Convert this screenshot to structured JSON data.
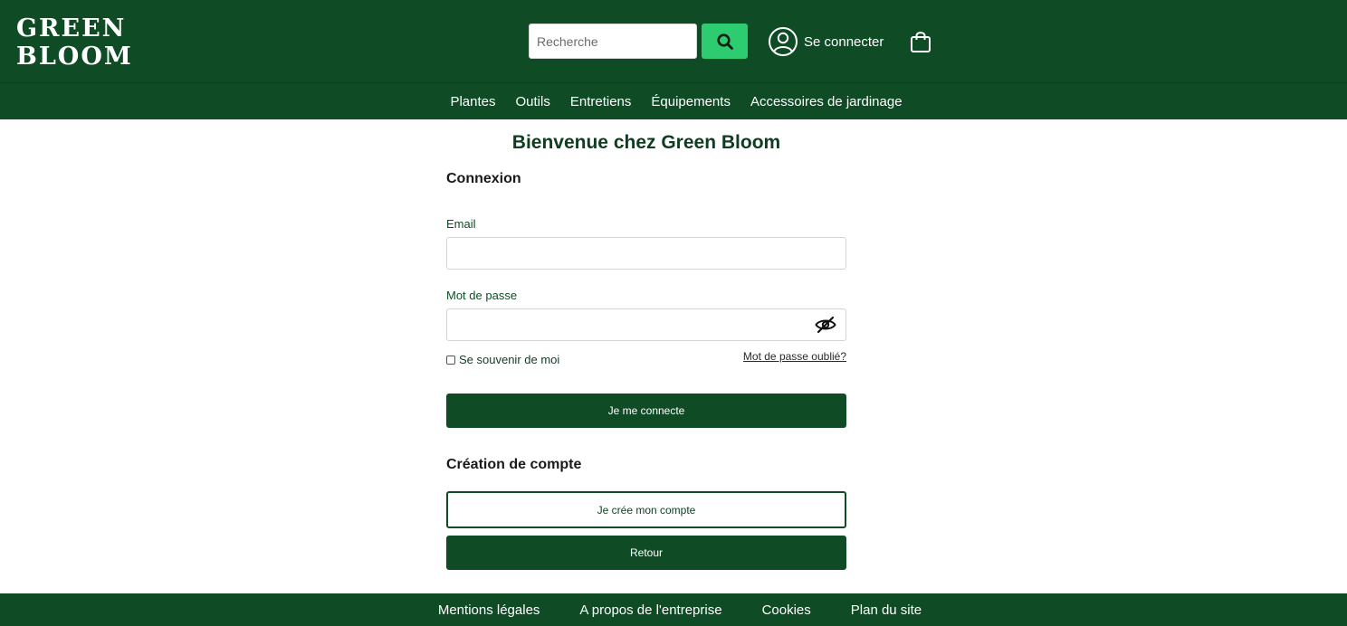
{
  "header": {
    "logo_line1": "GREEN",
    "logo_line2": "BLOOM",
    "search_placeholder": "Recherche",
    "account_label": "Se connecter"
  },
  "nav": {
    "items": [
      "Plantes",
      "Outils",
      "Entretiens",
      "Équipements",
      "Accessoires de jardinage"
    ]
  },
  "main": {
    "welcome": "Bienvenue chez Green Bloom",
    "login_title": "Connexion",
    "email_label": "Email",
    "email_value": "",
    "password_label": "Mot de passe",
    "password_value": "",
    "remember_label": "Se souvenir de moi",
    "remember_checked": false,
    "forgot_label": "Mot de passe oublié?",
    "login_button": "Je me connecte",
    "create_title": "Création de compte",
    "create_button": "Je crée mon compte",
    "back_button": "Retour"
  },
  "footer": {
    "items": [
      "Mentions légales",
      "A propos de l'entreprise",
      "Cookies",
      "Plan du site"
    ]
  },
  "colors": {
    "brand_green": "#0f4c26",
    "search_button": "#2ecc71",
    "background": "#ffffff"
  },
  "icons": {
    "search": "search-icon",
    "account": "user-circle-icon",
    "cart": "shopping-bag-icon",
    "password_toggle": "eye-slash-icon"
  }
}
